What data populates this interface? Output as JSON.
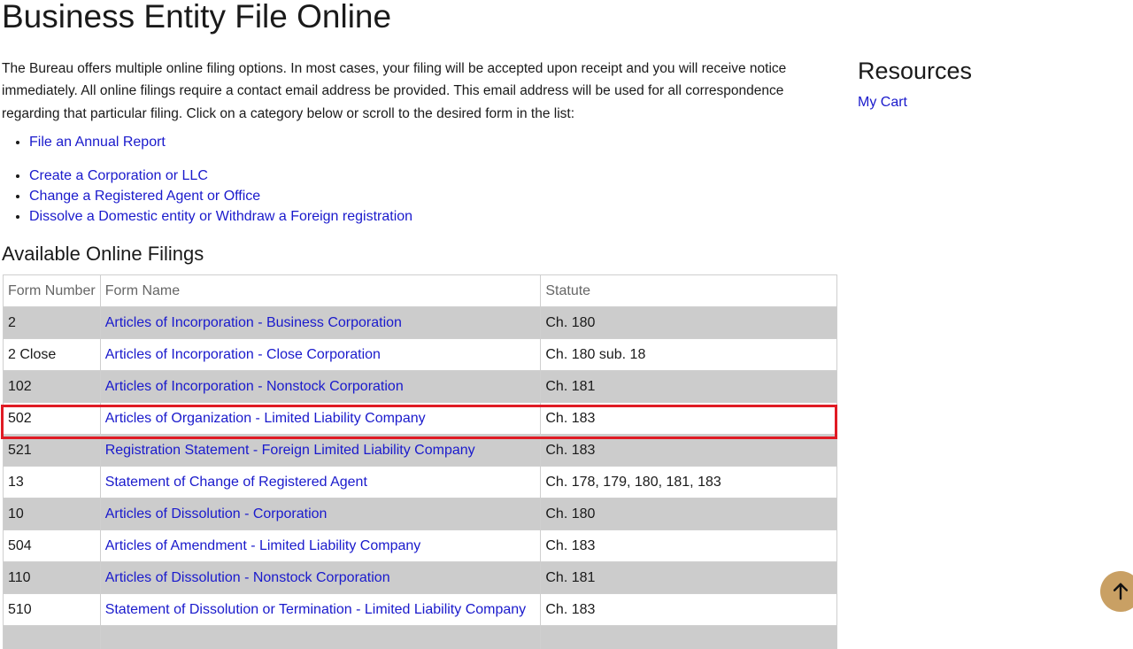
{
  "page": {
    "title": "Business Entity File Online",
    "intro": "The Bureau offers multiple online filing options. In most cases, your filing will be accepted upon receipt and you will receive notice immediately. All online filings require a contact email address be provided. This email address will be used for all correspondence regarding that particular filing. Click on a category below or scroll to the desired form in the list:"
  },
  "category_links": {
    "group_a": [
      "File an Annual Report"
    ],
    "group_b": [
      "Create a Corporation or LLC",
      "Change a Registered Agent or Office",
      "Dissolve a Domestic entity or Withdraw a Foreign registration"
    ]
  },
  "filings": {
    "heading": "Available Online Filings",
    "columns": [
      "Form Number",
      "Form Name",
      "Statute"
    ],
    "rows": [
      {
        "number": "2",
        "name": "Articles of Incorporation - Business Corporation",
        "statute": "Ch. 180"
      },
      {
        "number": "2 Close",
        "name": "Articles of Incorporation - Close Corporation",
        "statute": "Ch. 180 sub. 18"
      },
      {
        "number": "102",
        "name": "Articles of Incorporation - Nonstock Corporation",
        "statute": "Ch. 181"
      },
      {
        "number": "502",
        "name": "Articles of Organization - Limited Liability Company",
        "statute": "Ch. 183"
      },
      {
        "number": "521",
        "name": "Registration Statement - Foreign Limited Liability Company",
        "statute": "Ch. 183"
      },
      {
        "number": "13",
        "name": "Statement of Change of Registered Agent",
        "statute": "Ch. 178, 179, 180, 181, 183"
      },
      {
        "number": "10",
        "name": "Articles of Dissolution - Corporation",
        "statute": "Ch. 180"
      },
      {
        "number": "504",
        "name": "Articles of Amendment - Limited Liability Company",
        "statute": "Ch. 183"
      },
      {
        "number": "110",
        "name": "Articles of Dissolution - Nonstock Corporation",
        "statute": "Ch. 181"
      },
      {
        "number": "510",
        "name": "Statement of Dissolution or Termination - Limited Liability Company",
        "statute": "Ch. 183"
      }
    ],
    "highlighted_row": "502"
  },
  "sidebar": {
    "heading": "Resources",
    "links": [
      "My Cart"
    ]
  },
  "colors": {
    "link": "#1a1acc",
    "row_shade": "#cccccc",
    "highlight": "#e01b24",
    "back_to_top": "#c9a064"
  },
  "icons": {
    "back_to_top": "arrow-up-icon"
  }
}
